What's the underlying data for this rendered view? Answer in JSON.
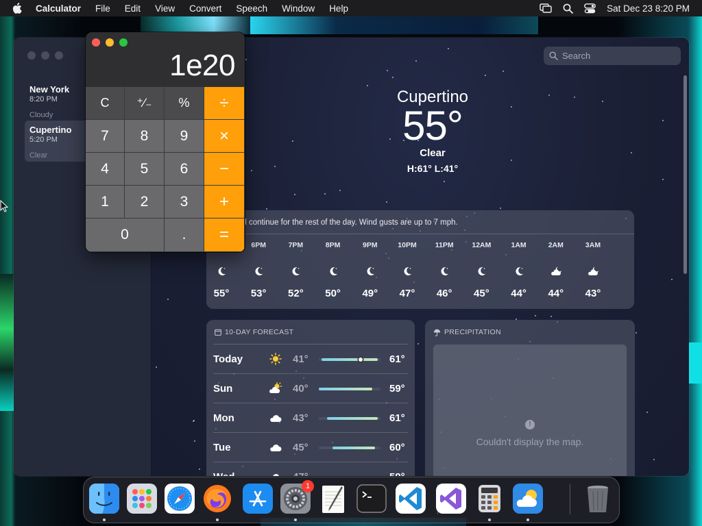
{
  "menubar": {
    "app_name": "Calculator",
    "items": [
      "File",
      "Edit",
      "View",
      "Convert",
      "Speech",
      "Window",
      "Help"
    ],
    "clock": "Sat Dec 23  8:20 PM",
    "icons": [
      "apple-logo",
      "screen-mirroring-icon",
      "search-icon",
      "control-center-icon"
    ]
  },
  "weather": {
    "search_placeholder": "Search",
    "cities": [
      {
        "name": "New York",
        "time": "8:20 PM",
        "condition": "Cloudy"
      },
      {
        "name": "Cupertino",
        "time": "5:20 PM",
        "condition": "Clear"
      }
    ],
    "current": {
      "city": "Cupertino",
      "temp": "55°",
      "condition": "Clear",
      "hilo": "H:61°  L:41°"
    },
    "hourly_summary": "nditions will continue for the rest of the day. Wind gusts are up to 7 mph.",
    "hourly": [
      {
        "label": "",
        "icon": "moon-icon",
        "temp": "55°"
      },
      {
        "label": "6PM",
        "icon": "moon-icon",
        "temp": "53°"
      },
      {
        "label": "7PM",
        "icon": "moon-icon",
        "temp": "52°"
      },
      {
        "label": "8PM",
        "icon": "moon-icon",
        "temp": "50°"
      },
      {
        "label": "9PM",
        "icon": "moon-icon",
        "temp": "49°"
      },
      {
        "label": "10PM",
        "icon": "moon-icon",
        "temp": "47°"
      },
      {
        "label": "11PM",
        "icon": "moon-icon",
        "temp": "46°"
      },
      {
        "label": "12AM",
        "icon": "moon-icon",
        "temp": "45°"
      },
      {
        "label": "1AM",
        "icon": "moon-icon",
        "temp": "44°"
      },
      {
        "label": "2AM",
        "icon": "cloud-moon-icon",
        "temp": "44°"
      },
      {
        "label": "3AM",
        "icon": "cloud-moon-icon",
        "temp": "43°"
      }
    ],
    "forecast_title": "10-DAY FORECAST",
    "forecast": [
      {
        "day": "Today",
        "icon": "sun-icon",
        "lo": "41°",
        "hi": "61°",
        "current": 55
      },
      {
        "day": "Sun",
        "icon": "partly-cloudy-icon",
        "lo": "40°",
        "hi": "59°"
      },
      {
        "day": "Mon",
        "icon": "cloud-icon",
        "lo": "43°",
        "hi": "61°"
      },
      {
        "day": "Tue",
        "icon": "cloud-icon",
        "lo": "45°",
        "hi": "60°"
      },
      {
        "day": "Wed",
        "icon": "cloud-icon",
        "lo": "47°",
        "hi": "59°"
      }
    ],
    "forecast_range": [
      40,
      62
    ],
    "precip_title": "PRECIPITATION",
    "precip_error": "Couldn't display the map."
  },
  "calculator": {
    "display": "1e20",
    "keys": {
      "clear": "C",
      "negate": "⁺∕₋",
      "percent": "%",
      "divide": "÷",
      "seven": "7",
      "eight": "8",
      "nine": "9",
      "multiply": "×",
      "four": "4",
      "five": "5",
      "six": "6",
      "minus": "−",
      "one": "1",
      "two": "2",
      "three": "3",
      "plus": "+",
      "zero": "0",
      "decimal": ".",
      "equals": "="
    },
    "colors": {
      "operator": "#ff9f0a",
      "function": "#4b4b4d",
      "digit": "#6a6a6c"
    }
  },
  "dock": {
    "apps": [
      {
        "name": "finder-icon",
        "running": true
      },
      {
        "name": "launchpad-icon",
        "running": false
      },
      {
        "name": "safari-icon",
        "running": false
      },
      {
        "name": "firefox-icon",
        "running": true
      },
      {
        "name": "app-store-icon",
        "running": false
      },
      {
        "name": "system-settings-icon",
        "running": true,
        "badge": "1"
      },
      {
        "name": "textedit-icon",
        "running": false
      },
      {
        "name": "terminal-icon",
        "running": false
      },
      {
        "name": "vscode-icon",
        "running": false
      },
      {
        "name": "visual-studio-icon",
        "running": false
      },
      {
        "name": "calculator-icon",
        "running": true
      },
      {
        "name": "weather-icon",
        "running": true
      },
      {
        "name": "trash-icon",
        "running": false
      }
    ]
  }
}
